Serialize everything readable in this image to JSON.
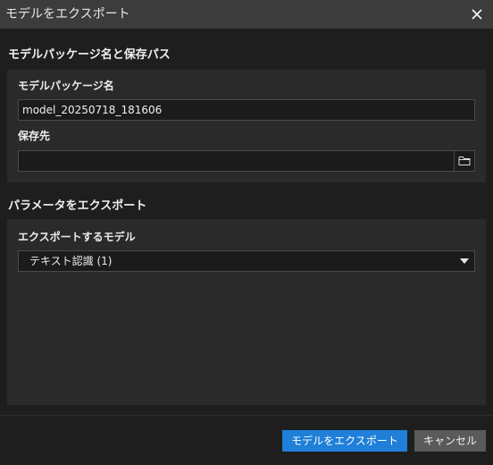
{
  "window": {
    "title": "モデルをエクスポート",
    "close_icon": "close-icon"
  },
  "package_section": {
    "heading": "モデルパッケージ名と保存パス",
    "name_label": "モデルパッケージ名",
    "name_value": "model_20250718_181606",
    "path_label": "保存先",
    "path_value": "",
    "browse_icon": "folder-icon"
  },
  "export_section": {
    "heading": "パラメータをエクスポート",
    "model_label": "エクスポートするモデル",
    "model_selected": "テキスト認識 (1)"
  },
  "footer": {
    "export_label": "モデルをエクスポート",
    "cancel_label": "キャンセル"
  },
  "colors": {
    "accent": "#1f7fd9",
    "panel": "#2a2a2a",
    "background": "#1e1e1e",
    "titlebar": "#3c3c3c"
  }
}
